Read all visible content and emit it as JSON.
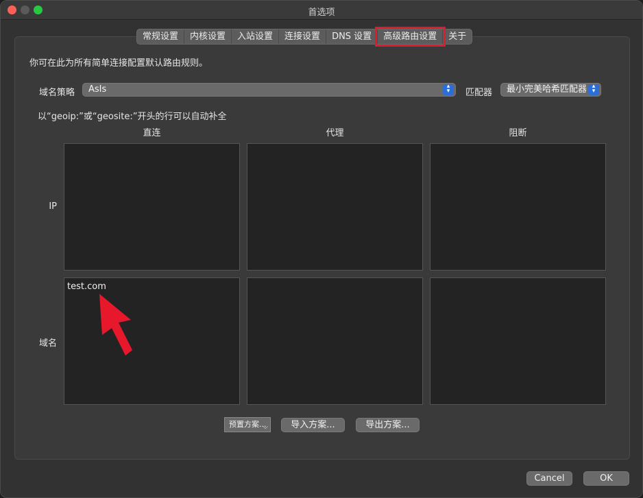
{
  "window": {
    "title": "首选项"
  },
  "tabs": [
    {
      "label": "常规设置"
    },
    {
      "label": "内核设置"
    },
    {
      "label": "入站设置"
    },
    {
      "label": "连接设置"
    },
    {
      "label": "DNS 设置"
    },
    {
      "label": "高级路由设置",
      "active": true
    },
    {
      "label": "关于"
    }
  ],
  "description": "你可在此为所有简单连接配置默认路由规则。",
  "domain_strategy": {
    "label": "域名策略",
    "value": "AsIs"
  },
  "matcher": {
    "label": "匹配器",
    "value": "最小完美哈希匹配器"
  },
  "hint": "以“geoip:”或“geosite:”开头的行可以自动补全",
  "columns": {
    "direct": "直连",
    "proxy": "代理",
    "block": "阻断"
  },
  "rows": {
    "ip": "IP",
    "domain": "域名"
  },
  "rules": {
    "ip_direct": "",
    "ip_proxy": "",
    "ip_block": "",
    "domain_direct": "test.com",
    "domain_proxy": "",
    "domain_block": ""
  },
  "buttons": {
    "preset": "预置方案...",
    "import": "导入方案...",
    "export": "导出方案...",
    "cancel": "Cancel",
    "ok": "OK"
  },
  "colors": {
    "highlight": "#e8182c",
    "accent": "#2c6ed8"
  }
}
